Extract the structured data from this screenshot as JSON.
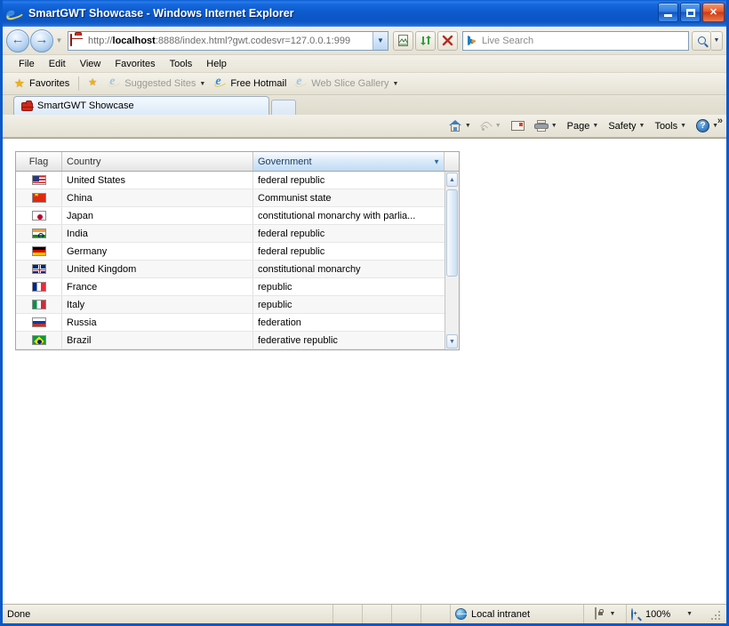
{
  "window": {
    "title": "SmartGWT Showcase - Windows Internet Explorer",
    "app_icon": "internet-explorer-icon",
    "controls": {
      "minimize": "Minimize",
      "maximize": "Maximize",
      "close": "Close"
    },
    "accent_titlebar": "#0B5ED2",
    "chrome_bg": "#EDEAE0"
  },
  "navigation": {
    "back_label": "Back",
    "forward_label": "Forward",
    "history_label": "Recent Pages",
    "address": {
      "scheme": "http://",
      "host": "localhost",
      "rest": ":8888/index.html?gwt.codesvr=127.0.0.1:999",
      "full": "http://localhost:8888/index.html?gwt.codesvr=127.0.0.1:999",
      "site_icon": "briefcase-icon",
      "dropdown_label": "Address dropdown"
    },
    "buttons": [
      {
        "name": "compatibility-view-button",
        "icon": "broken-page-icon"
      },
      {
        "name": "refresh-button",
        "icon": "refresh-icon"
      },
      {
        "name": "stop-button",
        "icon": "stop-x-icon"
      }
    ],
    "search": {
      "placeholder": "Live Search",
      "provider_icon": "bing-icon",
      "go_label": "Search",
      "dropdown_label": "Search options"
    }
  },
  "menubar": {
    "items": [
      {
        "label": "File"
      },
      {
        "label": "Edit"
      },
      {
        "label": "View"
      },
      {
        "label": "Favorites"
      },
      {
        "label": "Tools"
      },
      {
        "label": "Help"
      }
    ]
  },
  "favorites_bar": {
    "favorites_button": "Favorites",
    "items": [
      {
        "label": "Suggested Sites",
        "icon": "ie-icon",
        "dimmed": true,
        "has_caret": true
      },
      {
        "label": "Free Hotmail",
        "icon": "ie-icon",
        "dimmed": false,
        "has_caret": false
      },
      {
        "label": "Web Slice Gallery",
        "icon": "ie-icon",
        "dimmed": true,
        "has_caret": true
      }
    ]
  },
  "tabs": {
    "items": [
      {
        "label": "SmartGWT Showcase",
        "icon": "briefcase-icon",
        "active": true
      }
    ],
    "new_tab_label": "New Tab"
  },
  "command_bar": {
    "items": [
      {
        "name": "home-button",
        "label": "",
        "icon": "home-icon",
        "caret": true,
        "dimmed": false
      },
      {
        "name": "feeds-button",
        "label": "",
        "icon": "rss-icon",
        "caret": true,
        "dimmed": true
      },
      {
        "name": "read-mail-button",
        "label": "",
        "icon": "mail-icon",
        "caret": false,
        "dimmed": false
      },
      {
        "name": "print-button",
        "label": "",
        "icon": "printer-icon",
        "caret": true,
        "dimmed": false
      },
      {
        "name": "page-menu",
        "label": "Page",
        "icon": "",
        "caret": true,
        "dimmed": false
      },
      {
        "name": "safety-menu",
        "label": "Safety",
        "icon": "",
        "caret": true,
        "dimmed": false
      },
      {
        "name": "tools-menu",
        "label": "Tools",
        "icon": "",
        "caret": true,
        "dimmed": false
      },
      {
        "name": "help-menu",
        "label": "",
        "icon": "help-icon",
        "caret": true,
        "dimmed": false
      }
    ],
    "overflow_label": "»"
  },
  "grid": {
    "columns": [
      {
        "key": "flag",
        "label": "Flag",
        "selected": false,
        "has_menu": false
      },
      {
        "key": "country",
        "label": "Country",
        "selected": false,
        "has_menu": false
      },
      {
        "key": "government",
        "label": "Government",
        "selected": true,
        "has_menu": true
      }
    ],
    "rows": [
      {
        "flag": "flag-us",
        "flag_name": "flag-united-states",
        "country": "United States",
        "government": "federal republic"
      },
      {
        "flag": "flag-cn",
        "flag_name": "flag-china",
        "country": "China",
        "government": "Communist state"
      },
      {
        "flag": "flag-jp",
        "flag_name": "flag-japan",
        "country": "Japan",
        "government": "constitutional monarchy with parlia..."
      },
      {
        "flag": "flag-in",
        "flag_name": "flag-india",
        "country": "India",
        "government": "federal republic"
      },
      {
        "flag": "flag-de",
        "flag_name": "flag-germany",
        "country": "Germany",
        "government": "federal republic"
      },
      {
        "flag": "flag-gb",
        "flag_name": "flag-united-kingdom",
        "country": "United Kingdom",
        "government": "constitutional monarchy"
      },
      {
        "flag": "flag-fr",
        "flag_name": "flag-france",
        "country": "France",
        "government": "republic"
      },
      {
        "flag": "flag-it",
        "flag_name": "flag-italy",
        "country": "Italy",
        "government": "republic"
      },
      {
        "flag": "flag-ru",
        "flag_name": "flag-russia",
        "country": "Russia",
        "government": "federation"
      },
      {
        "flag": "flag-br",
        "flag_name": "flag-brazil",
        "country": "Brazil",
        "government": "federative republic"
      }
    ],
    "scrollbar": {
      "up_label": "Scroll up",
      "down_label": "Scroll down",
      "thumb_percent": 60
    }
  },
  "statusbar": {
    "status": "Done",
    "zone": "Local intranet",
    "zone_icon": "globe-icon",
    "protected_mode_icon": "shield-icon",
    "zoom": "100%",
    "zoom_icon": "zoom-icon"
  }
}
